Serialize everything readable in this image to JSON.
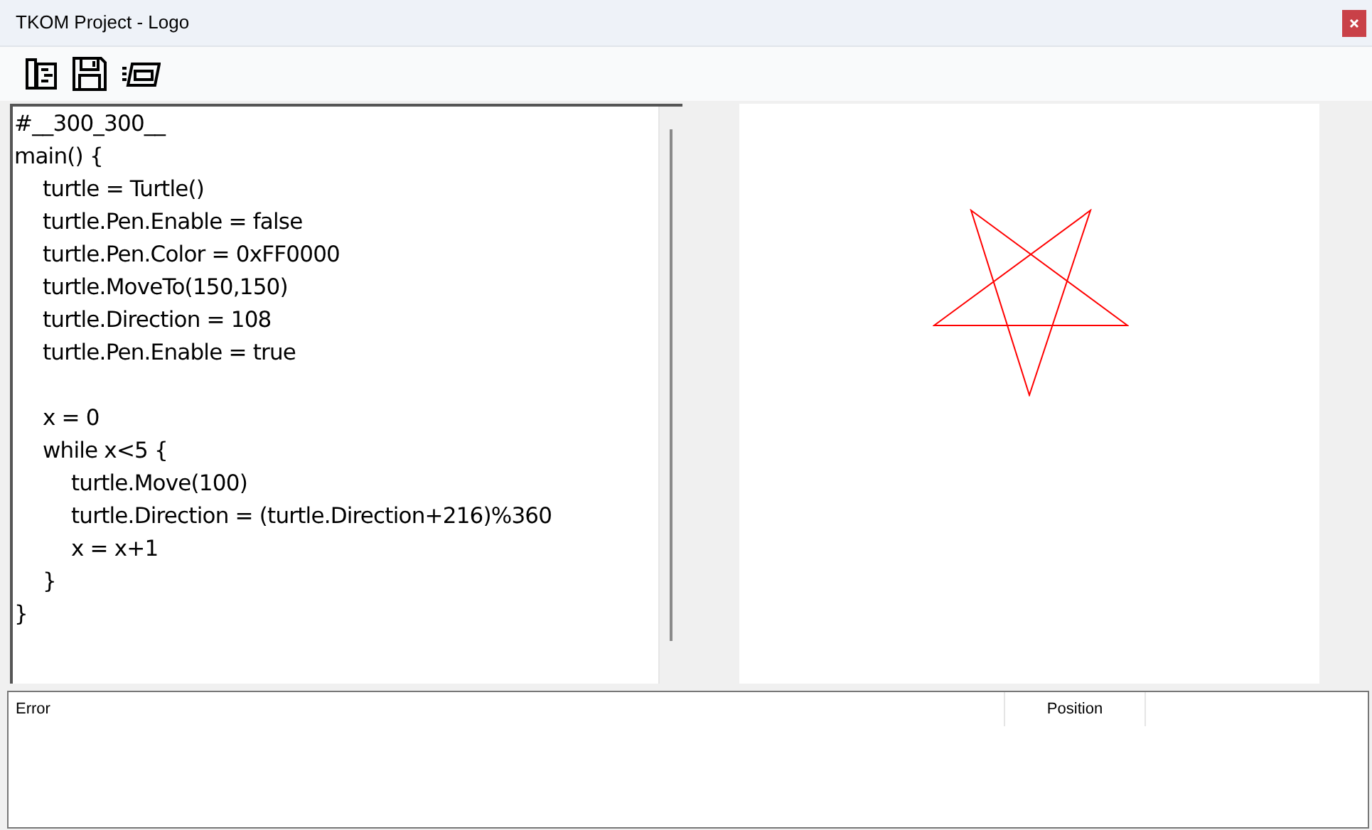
{
  "window": {
    "title": "TKOM Project - Logo"
  },
  "code": [
    {
      "kind": "code",
      "text": "#__300_300__"
    },
    {
      "kind": "code",
      "text": "main() {",
      "children": [
        {
          "kind": "code",
          "text": "turtle = Turtle()"
        },
        {
          "kind": "code",
          "text": "turtle.Pen.Enable = false"
        },
        {
          "kind": "code",
          "text": "turtle.Pen.Color = 0xFF0000"
        },
        {
          "kind": "code",
          "text": "turtle.MoveTo(150,150)"
        },
        {
          "kind": "code",
          "text": "turtle.Direction = 108"
        },
        {
          "kind": "code",
          "text": "turtle.Pen.Enable = true"
        },
        {
          "kind": "blank"
        },
        {
          "kind": "code",
          "text": "x = 0"
        },
        {
          "kind": "code",
          "text": "while x<5 {",
          "children": [
            {
              "kind": "code",
              "text": "turtle.Move(100)"
            },
            {
              "kind": "code",
              "text": "turtle.Direction = (turtle.Direction+216)%360"
            },
            {
              "kind": "code",
              "text": "x = x+1"
            }
          ]
        },
        {
          "kind": "code",
          "text": "}"
        }
      ]
    },
    {
      "kind": "code",
      "text": "}"
    }
  ],
  "errors": {
    "columns": [
      "Error",
      "Position"
    ]
  }
}
